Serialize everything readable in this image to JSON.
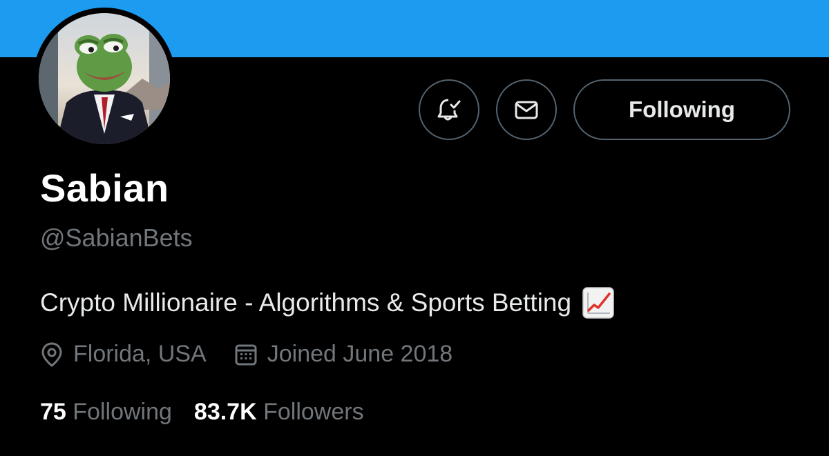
{
  "profile": {
    "display_name": "Sabian",
    "handle": "@SabianBets",
    "bio": "Crypto Millionaire - Algorithms & Sports Betting",
    "bio_emoji_icon": "chart-increasing-icon",
    "location": "Florida, USA",
    "joined": "Joined June 2018"
  },
  "actions": {
    "notify_icon": "bell-check-icon",
    "message_icon": "envelope-icon",
    "follow_label": "Following"
  },
  "stats": {
    "following_count": "75",
    "following_label": "Following",
    "followers_count": "83.7K",
    "followers_label": "Followers"
  },
  "colors": {
    "banner": "#1d9bf0",
    "background": "#000000",
    "primary_text": "#e7e9ea",
    "secondary_text": "#71767b",
    "button_border": "#536471"
  }
}
